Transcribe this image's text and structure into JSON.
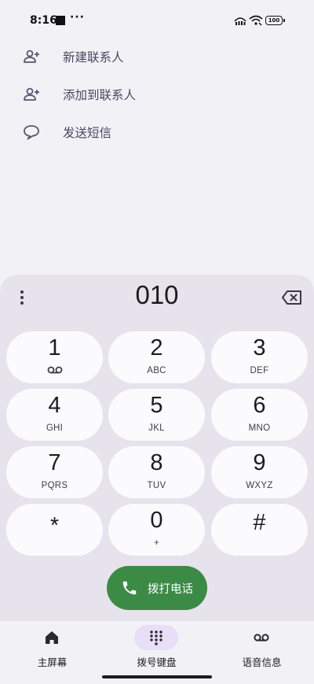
{
  "status_bar": {
    "time": "8:16",
    "dots": "···",
    "battery": "100"
  },
  "actions": [
    {
      "label": "新建联系人",
      "icon": "add-person-icon"
    },
    {
      "label": "添加到联系人",
      "icon": "add-person-icon"
    },
    {
      "label": "发送短信",
      "icon": "message-icon"
    }
  ],
  "dialpad": {
    "digits": "010",
    "keys": [
      {
        "num": "1",
        "sub": ""
      },
      {
        "num": "2",
        "sub": "ABC"
      },
      {
        "num": "3",
        "sub": "DEF"
      },
      {
        "num": "4",
        "sub": "GHI"
      },
      {
        "num": "5",
        "sub": "JKL"
      },
      {
        "num": "6",
        "sub": "MNO"
      },
      {
        "num": "7",
        "sub": "PQRS"
      },
      {
        "num": "8",
        "sub": "TUV"
      },
      {
        "num": "9",
        "sub": "WXYZ"
      },
      {
        "num": "*",
        "sub": ""
      },
      {
        "num": "0",
        "sub": "+"
      },
      {
        "num": "#",
        "sub": ""
      }
    ],
    "call_label": "拨打电话"
  },
  "bottom_nav": {
    "items": [
      {
        "label": "主屏幕",
        "icon": "home-icon",
        "active": false
      },
      {
        "label": "拨号键盘",
        "icon": "dialpad-icon",
        "active": true
      },
      {
        "label": "语音信息",
        "icon": "voicemail-icon",
        "active": false
      }
    ]
  },
  "colors": {
    "background": "#f2f1f6",
    "dialpad_panel": "#e6e3ec",
    "key": "#fbfafd",
    "call_button": "#3b8b46",
    "nav_active_pill": "#e8def8",
    "action_text": "#4a4660"
  }
}
